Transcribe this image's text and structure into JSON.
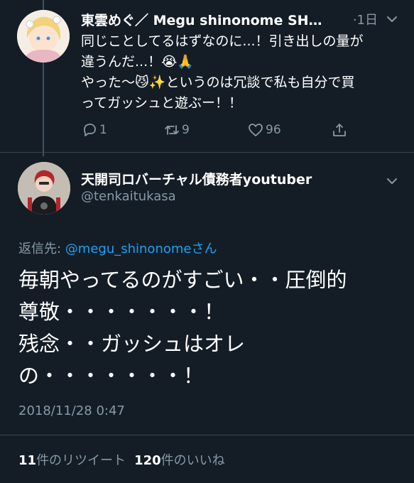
{
  "parent_tweet": {
    "display_name": "東雲めぐ／ Megu shinonome SHO...",
    "time": "·1日",
    "lines": [
      "同じことしてるはずなのに...！引き出しの量が",
      "違うんだ...！😭🙏",
      "やった〜😼✨というのは冗談で私も自分で買",
      "ってガッシュと遊ぶー！！"
    ],
    "reply_count": "1",
    "retweet_count": "9",
    "like_count": "96"
  },
  "reply_tweet": {
    "display_name": "天開司ロバーチャル債務者youtuber",
    "handle": "@tenkaitukasa",
    "reply_to_prefix": "返信先: ",
    "reply_to_mention": "@megu_shinonome",
    "reply_to_suffix": "さん",
    "lines": [
      "毎朝やってるのがすごい・・圧倒的",
      "尊敬・・・・・・・！",
      "残念・・ガッシュはオレ",
      "の・・・・・・・！"
    ],
    "timestamp": "2018/11/28 0:47",
    "retweets_value": "11",
    "retweets_label": "件のリツイート",
    "likes_value": "120",
    "likes_label": "件のいいね"
  },
  "colors": {
    "background": "#141d26",
    "secondary_text": "#8899a6",
    "link": "#1da1f2",
    "divider": "#38444d"
  },
  "icons": [
    "chevron-down-icon",
    "reply-icon",
    "retweet-icon",
    "like-icon",
    "share-icon"
  ]
}
